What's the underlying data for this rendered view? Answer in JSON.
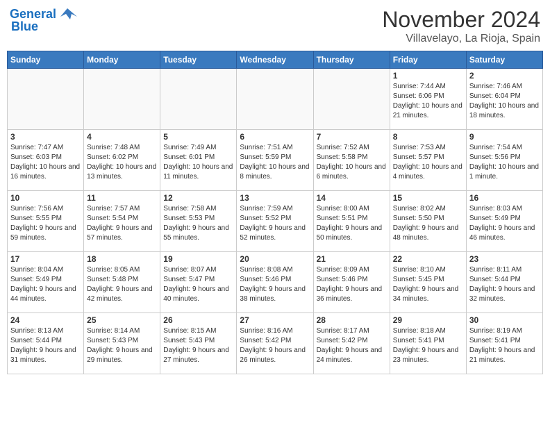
{
  "header": {
    "logo_line1": "General",
    "logo_line2": "Blue",
    "month": "November 2024",
    "location": "Villavelayo, La Rioja, Spain"
  },
  "weekdays": [
    "Sunday",
    "Monday",
    "Tuesday",
    "Wednesday",
    "Thursday",
    "Friday",
    "Saturday"
  ],
  "weeks": [
    [
      {
        "day": "",
        "info": ""
      },
      {
        "day": "",
        "info": ""
      },
      {
        "day": "",
        "info": ""
      },
      {
        "day": "",
        "info": ""
      },
      {
        "day": "",
        "info": ""
      },
      {
        "day": "1",
        "info": "Sunrise: 7:44 AM\nSunset: 6:06 PM\nDaylight: 10 hours and 21 minutes."
      },
      {
        "day": "2",
        "info": "Sunrise: 7:46 AM\nSunset: 6:04 PM\nDaylight: 10 hours and 18 minutes."
      }
    ],
    [
      {
        "day": "3",
        "info": "Sunrise: 7:47 AM\nSunset: 6:03 PM\nDaylight: 10 hours and 16 minutes."
      },
      {
        "day": "4",
        "info": "Sunrise: 7:48 AM\nSunset: 6:02 PM\nDaylight: 10 hours and 13 minutes."
      },
      {
        "day": "5",
        "info": "Sunrise: 7:49 AM\nSunset: 6:01 PM\nDaylight: 10 hours and 11 minutes."
      },
      {
        "day": "6",
        "info": "Sunrise: 7:51 AM\nSunset: 5:59 PM\nDaylight: 10 hours and 8 minutes."
      },
      {
        "day": "7",
        "info": "Sunrise: 7:52 AM\nSunset: 5:58 PM\nDaylight: 10 hours and 6 minutes."
      },
      {
        "day": "8",
        "info": "Sunrise: 7:53 AM\nSunset: 5:57 PM\nDaylight: 10 hours and 4 minutes."
      },
      {
        "day": "9",
        "info": "Sunrise: 7:54 AM\nSunset: 5:56 PM\nDaylight: 10 hours and 1 minute."
      }
    ],
    [
      {
        "day": "10",
        "info": "Sunrise: 7:56 AM\nSunset: 5:55 PM\nDaylight: 9 hours and 59 minutes."
      },
      {
        "day": "11",
        "info": "Sunrise: 7:57 AM\nSunset: 5:54 PM\nDaylight: 9 hours and 57 minutes."
      },
      {
        "day": "12",
        "info": "Sunrise: 7:58 AM\nSunset: 5:53 PM\nDaylight: 9 hours and 55 minutes."
      },
      {
        "day": "13",
        "info": "Sunrise: 7:59 AM\nSunset: 5:52 PM\nDaylight: 9 hours and 52 minutes."
      },
      {
        "day": "14",
        "info": "Sunrise: 8:00 AM\nSunset: 5:51 PM\nDaylight: 9 hours and 50 minutes."
      },
      {
        "day": "15",
        "info": "Sunrise: 8:02 AM\nSunset: 5:50 PM\nDaylight: 9 hours and 48 minutes."
      },
      {
        "day": "16",
        "info": "Sunrise: 8:03 AM\nSunset: 5:49 PM\nDaylight: 9 hours and 46 minutes."
      }
    ],
    [
      {
        "day": "17",
        "info": "Sunrise: 8:04 AM\nSunset: 5:49 PM\nDaylight: 9 hours and 44 minutes."
      },
      {
        "day": "18",
        "info": "Sunrise: 8:05 AM\nSunset: 5:48 PM\nDaylight: 9 hours and 42 minutes."
      },
      {
        "day": "19",
        "info": "Sunrise: 8:07 AM\nSunset: 5:47 PM\nDaylight: 9 hours and 40 minutes."
      },
      {
        "day": "20",
        "info": "Sunrise: 8:08 AM\nSunset: 5:46 PM\nDaylight: 9 hours and 38 minutes."
      },
      {
        "day": "21",
        "info": "Sunrise: 8:09 AM\nSunset: 5:46 PM\nDaylight: 9 hours and 36 minutes."
      },
      {
        "day": "22",
        "info": "Sunrise: 8:10 AM\nSunset: 5:45 PM\nDaylight: 9 hours and 34 minutes."
      },
      {
        "day": "23",
        "info": "Sunrise: 8:11 AM\nSunset: 5:44 PM\nDaylight: 9 hours and 32 minutes."
      }
    ],
    [
      {
        "day": "24",
        "info": "Sunrise: 8:13 AM\nSunset: 5:44 PM\nDaylight: 9 hours and 31 minutes."
      },
      {
        "day": "25",
        "info": "Sunrise: 8:14 AM\nSunset: 5:43 PM\nDaylight: 9 hours and 29 minutes."
      },
      {
        "day": "26",
        "info": "Sunrise: 8:15 AM\nSunset: 5:43 PM\nDaylight: 9 hours and 27 minutes."
      },
      {
        "day": "27",
        "info": "Sunrise: 8:16 AM\nSunset: 5:42 PM\nDaylight: 9 hours and 26 minutes."
      },
      {
        "day": "28",
        "info": "Sunrise: 8:17 AM\nSunset: 5:42 PM\nDaylight: 9 hours and 24 minutes."
      },
      {
        "day": "29",
        "info": "Sunrise: 8:18 AM\nSunset: 5:41 PM\nDaylight: 9 hours and 23 minutes."
      },
      {
        "day": "30",
        "info": "Sunrise: 8:19 AM\nSunset: 5:41 PM\nDaylight: 9 hours and 21 minutes."
      }
    ]
  ]
}
